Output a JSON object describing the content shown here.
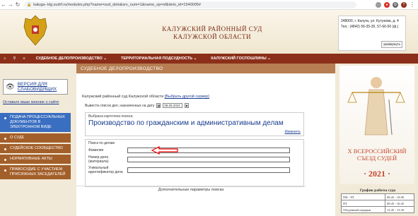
{
  "browser": {
    "url": "kaluga--klg.sudrf.ru/modules.php?name=sud_delo&srv_num=1&name_op=sf&delo_id=1540005#",
    "ext_letter": "T"
  },
  "header": {
    "title_line1": "КАЛУЖСКИЙ РАЙОННЫЙ СУД",
    "title_line2": "КАЛУЖСКОЙ ОБЛАСТИ",
    "contact_address": "248000, г. Калуга, ул. Кутузова, д. 4",
    "contact_phone": "Тел.: (4842) 56-35-30, 57-66-50 (ф.)",
    "expand_label": "развернуть"
  },
  "menu": {
    "items": [
      {
        "label": "СУДЕБНОЕ ДЕЛОПРОИЗВОДСТВО ⌄"
      },
      {
        "label": "ТЕРРИТОРИАЛЬНАЯ ПОДСУДНОСТЬ ⌄"
      },
      {
        "label": "КАЛУЖСКИЙ ГОСПОШЛИНЫ ⌄"
      }
    ]
  },
  "sidebar": {
    "vision_label": "ВЕРСИЯ ДЛЯ СЛАБОВИДЯЩИХ",
    "opinion_link": "Оставьте ваше мнение о сайте",
    "items": [
      {
        "label": "ПОДАЧА ПРОЦЕССУАЛЬНЫХ ДОКУМЕНТОВ В ЭЛЕКТРОННОМ ВИДЕ"
      },
      {
        "label": "О СУДЕ"
      },
      {
        "label": "СУДЕЙСКОЕ СООБЩЕСТВО"
      },
      {
        "label": "НОРМАТИВНЫЕ АКТЫ"
      },
      {
        "label": "ПРАВОСУДИЕ С УЧАСТИЕМ ПРИСЯЖНЫХ ЗАСЕДАТЕЛЕЙ"
      }
    ]
  },
  "main": {
    "section_title": "СУДЕБНОЕ ДЕЛОПРОИЗВОДСТВО",
    "court_name": "Калужский районный суд Калужской области",
    "change_server": "[Выбрать другой сервер]",
    "date_label": "Вывести список дел, назначенных на дату",
    "date_value": "08.05.2021",
    "card_label": "Выбрана картотека поиска:",
    "card_value": "Производство по гражданским и административным делам",
    "change_label": "Изменить",
    "search_title": "Поиск по делам",
    "fields": [
      {
        "label": "Фамилия"
      },
      {
        "label": "Номер дела (материала)"
      },
      {
        "label": "Уникальный идентификатор дела"
      }
    ],
    "extra_params": "Дополнительные параметры поиска"
  },
  "right": {
    "congress_line1": "X ВСЕРОССИЙСКИЙ",
    "congress_line2": "СЪЕЗД СУДЕЙ",
    "congress_year": "· 2021 ·",
    "schedule_title": "График работы суда",
    "schedule": [
      {
        "day": "ПН - ЧТ",
        "time": "08:45 - 18:00"
      },
      {
        "day": "ПТ",
        "time": "08:45 - 16:45"
      },
      {
        "day": "Обеденный перерыв",
        "time": "12:45 - 13:30"
      }
    ]
  },
  "colors": {
    "menu_bg": "#8b2f1a",
    "side_active": "#3a6ec1",
    "side_normal": "#a35f2a",
    "section_header": "#b67e52",
    "title_red": "#7a2b18"
  }
}
